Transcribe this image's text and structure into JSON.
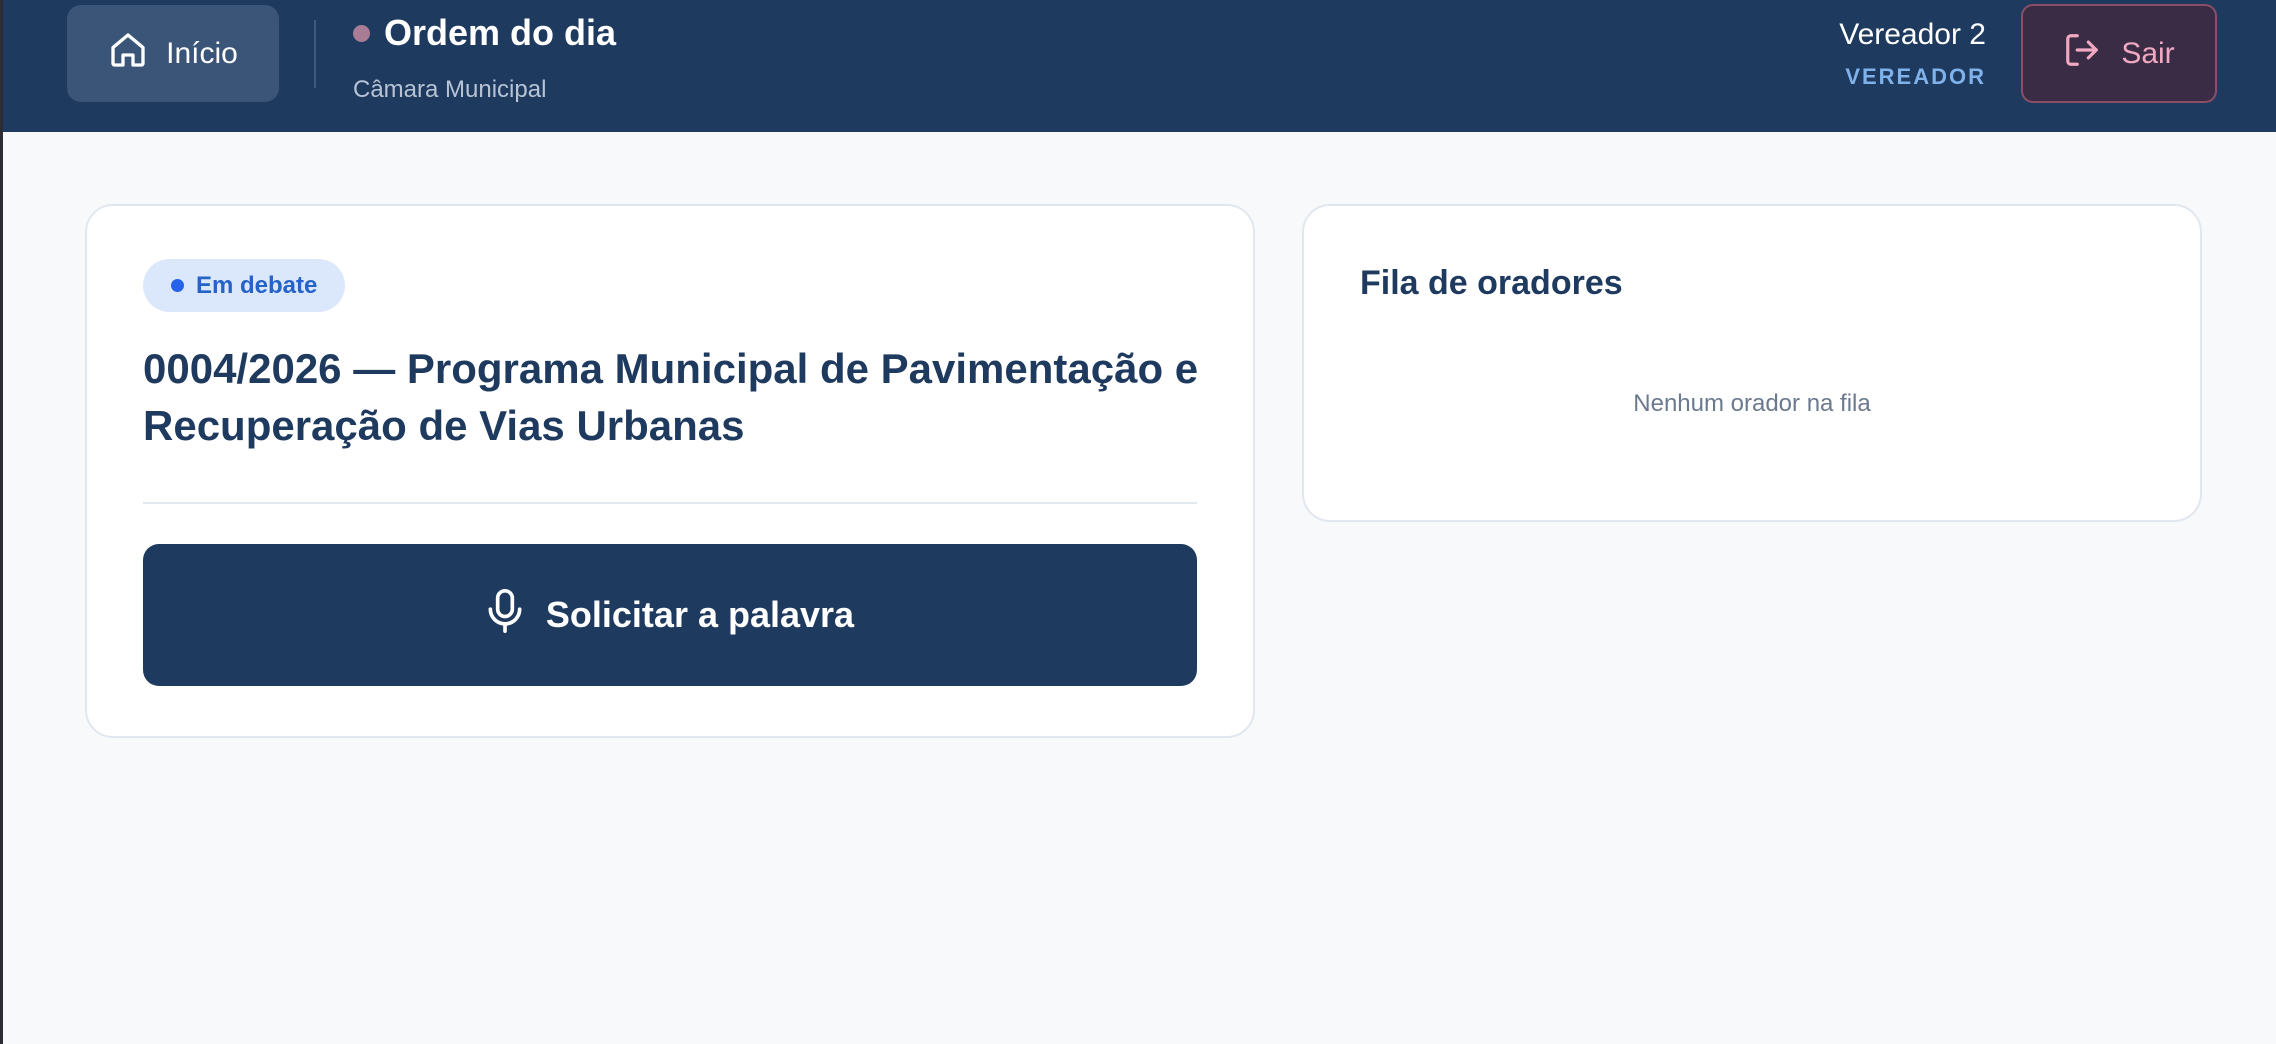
{
  "header": {
    "home_label": "Início",
    "page_title": "Ordem do dia",
    "subtitle": "Câmara Municipal",
    "user_name": "Vereador 2",
    "user_role": "VEREADOR",
    "logout_label": "Sair",
    "status_dot_color": "#a87c94"
  },
  "agenda_item": {
    "status_badge": "Em debate",
    "title": "0004/2026 — Programa Municipal de Pavimentação e Recuperação de Vias Urbanas",
    "request_button_label": "Solicitar a palavra",
    "request_button_icon": "microphone-icon"
  },
  "speakers_queue": {
    "title": "Fila de oradores",
    "empty_message": "Nenhum orador na fila"
  },
  "colors": {
    "header_bg": "#1f3a5f",
    "primary": "#1f3a5f",
    "badge_bg": "#dbe8fb",
    "badge_text": "#2563c9",
    "role_text": "#7fb2ea",
    "logout_text": "#f0a9c0"
  }
}
